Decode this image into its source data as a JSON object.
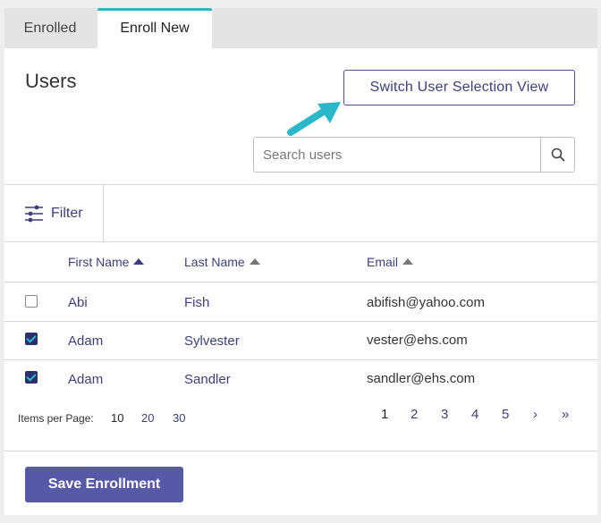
{
  "tabs": [
    {
      "label": "Enrolled"
    },
    {
      "label": "Enroll New"
    }
  ],
  "page": {
    "title": "Users",
    "switch_label": "Switch User Selection View"
  },
  "search": {
    "placeholder": "Search users",
    "value": ""
  },
  "filter": {
    "label": "Filter"
  },
  "table": {
    "columns": [
      "First Name",
      "Last Name",
      "Email"
    ],
    "rows": [
      {
        "checked": false,
        "first": "Abi",
        "last": "Fish",
        "email": "abifish@yahoo.com"
      },
      {
        "checked": true,
        "first": "Adam",
        "last": "Sylvester",
        "email": "vester@ehs.com"
      },
      {
        "checked": true,
        "first": "Adam",
        "last": "Sandler",
        "email": "sandler@ehs.com"
      }
    ]
  },
  "pagination": {
    "items_per_page_label": "Items per Page:",
    "sizes": [
      "10",
      "20",
      "30"
    ],
    "selected_size": "10",
    "pages": [
      "1",
      "2",
      "3",
      "4",
      "5"
    ],
    "current_page": "1",
    "next": "›",
    "last": "»"
  },
  "actions": {
    "save_label": "Save Enrollment"
  },
  "colors": {
    "accent": "#2ab7c9",
    "primary": "#565aa6",
    "link": "#3c3f7a"
  }
}
